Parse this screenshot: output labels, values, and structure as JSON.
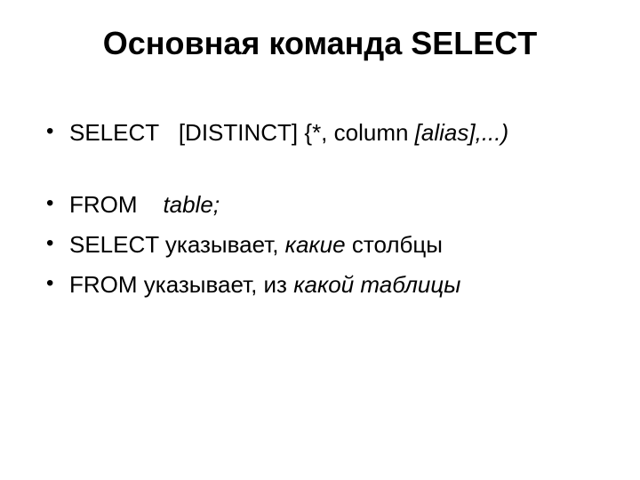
{
  "title": "Основная команда SELECT",
  "bullets": {
    "item1": {
      "kw": "SELECT   ",
      "rest_plain": "[DISTINCT] {*, column ",
      "rest_italic": "[alias],...)"
    },
    "item2": {
      "kw": "FROM    ",
      "tab": "table;"
    },
    "item3": {
      "pre": "SELECT указывает, ",
      "it": "какие",
      "post": " столбцы"
    },
    "item4": {
      "pre": "FROM указывает, из ",
      "it": "какой таблицы"
    }
  }
}
